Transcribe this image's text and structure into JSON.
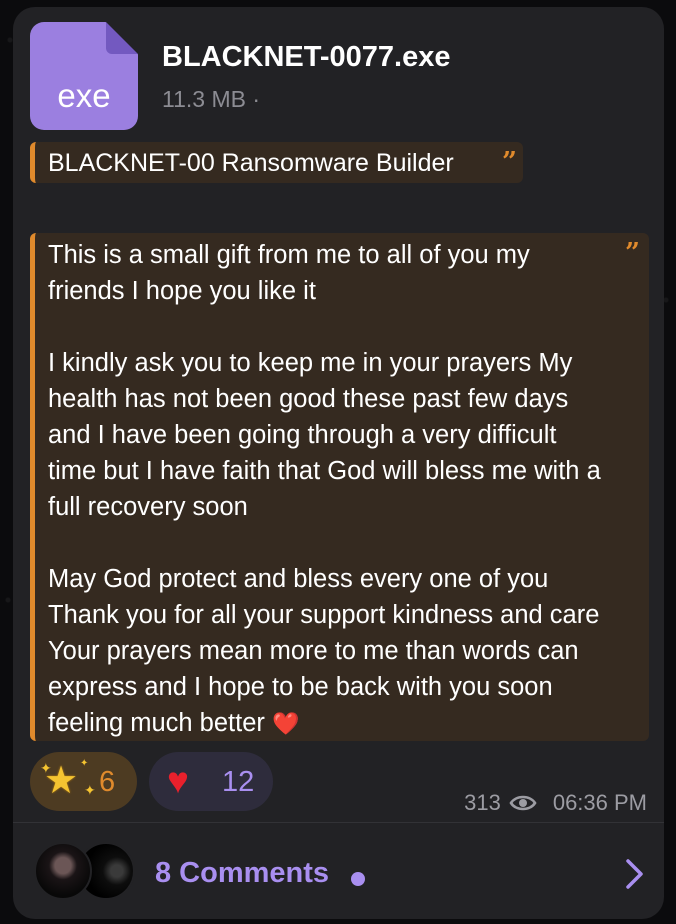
{
  "file": {
    "extension": "exe",
    "name": "BLACKNET-0077.exe",
    "size": "11.3 MB ·"
  },
  "caption_quote": "BLACKNET-00 Ransomware Builder",
  "message_quote": {
    "text": "This is a small gift from me to all of you my friends I hope you like it\n\nI kindly ask you to keep me in your prayers My health has not been good these past few days and I have been going through a very difficult time but I have faith that God will bless me with a full recovery soon\n\nMay God protect and bless every one of you Thank you for all your support kindness and care Your prayers mean more to me than words can express and I hope to be back with you soon feeling much better",
    "trailing_emoji": "❤️"
  },
  "reactions": [
    {
      "icon": "star-icon",
      "count": "6",
      "color": "#e08a2c"
    },
    {
      "icon": "heart-icon",
      "count": "12",
      "color": "#a98ff0"
    }
  ],
  "meta": {
    "views": "313",
    "time": "06:36 PM"
  },
  "comments": {
    "label": "8 Comments"
  },
  "colors": {
    "accent": "#a98ff0",
    "quote_bar": "#e08a2c",
    "bubble": "#222225"
  }
}
